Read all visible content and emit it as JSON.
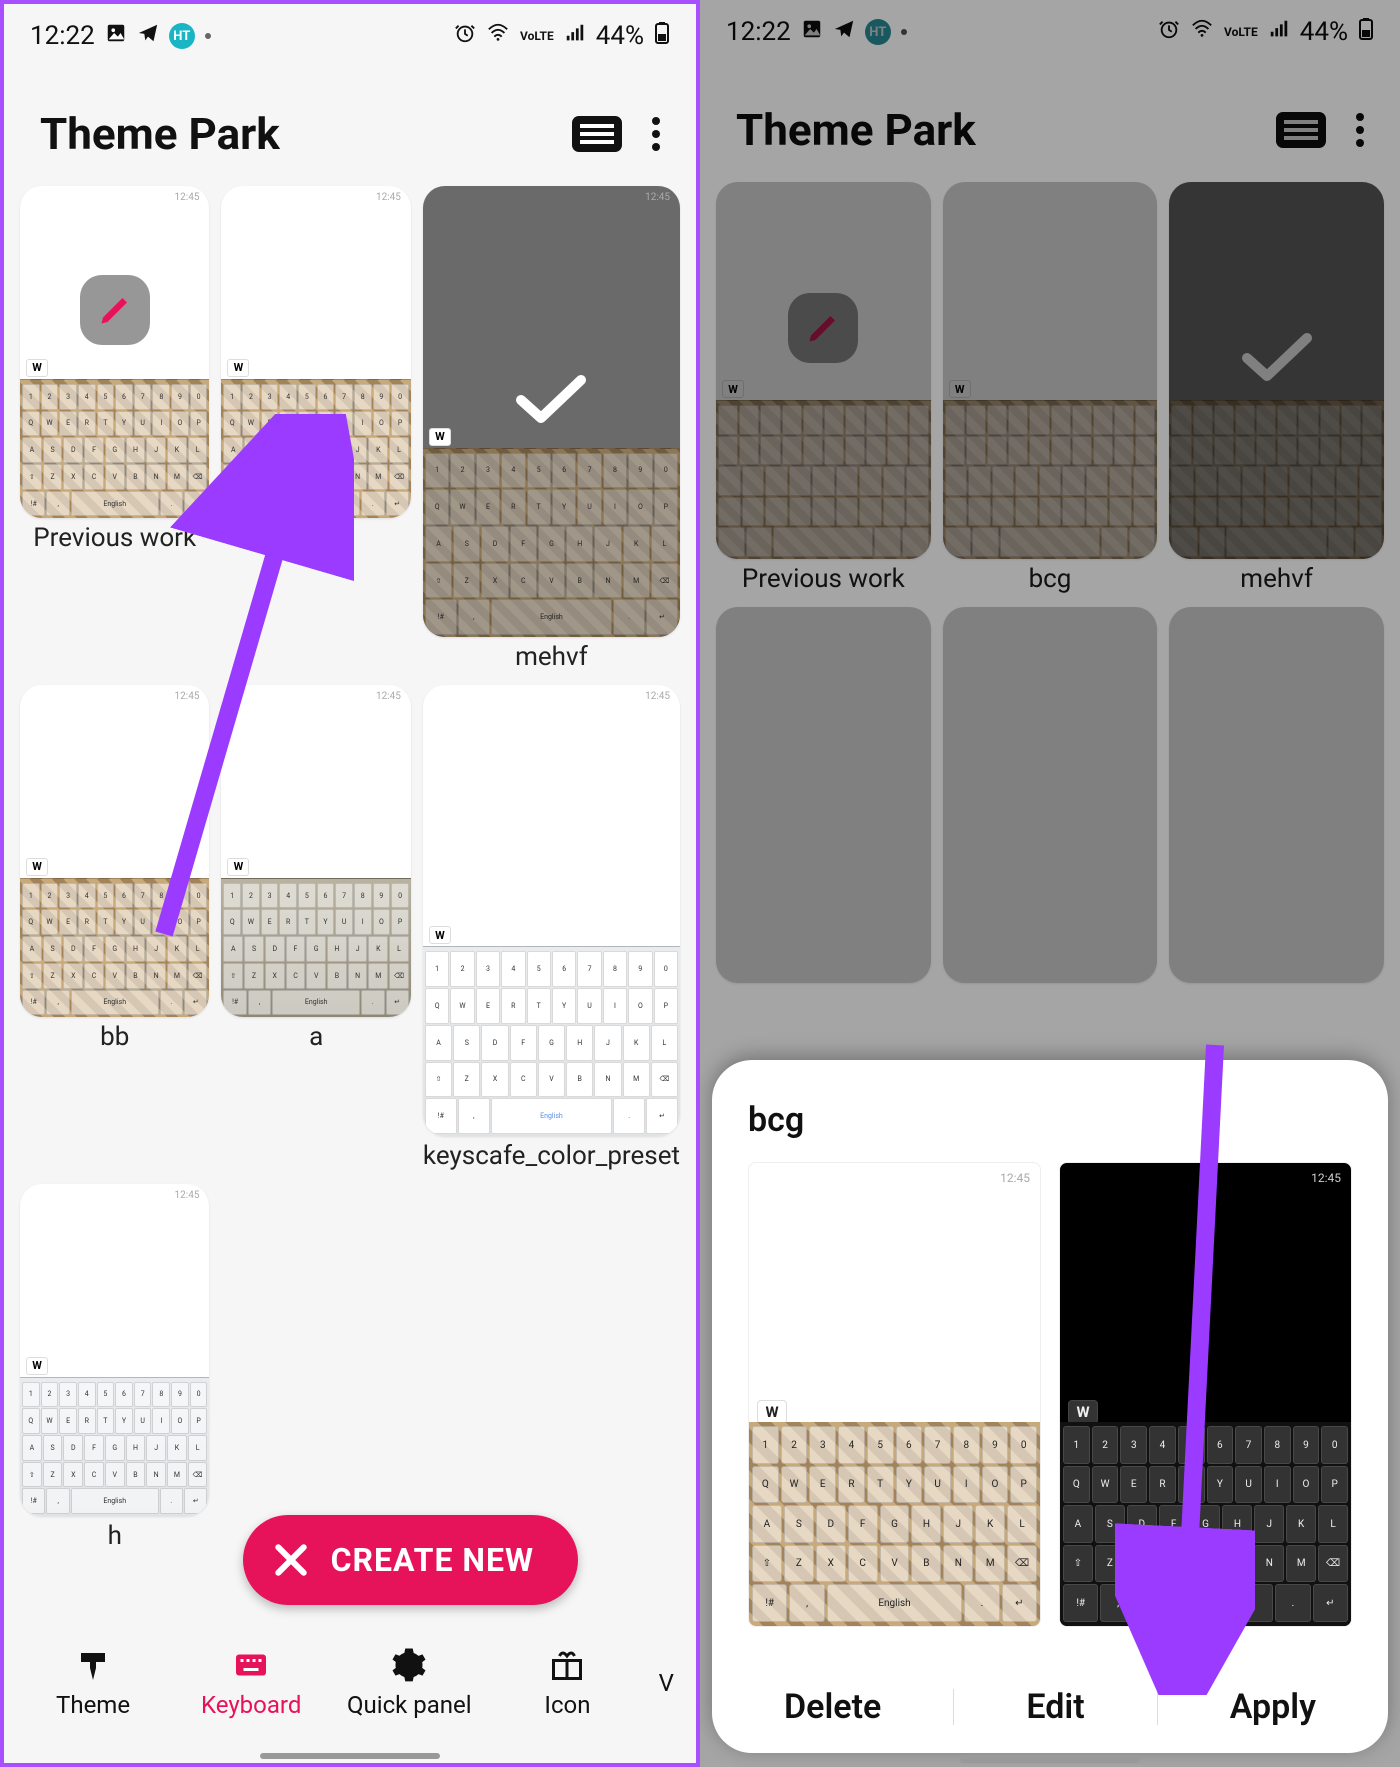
{
  "status": {
    "time": "12:22",
    "battery_text": "44%",
    "volte": "VoLTE"
  },
  "app": {
    "title": "Theme Park"
  },
  "themes": [
    {
      "label": "Previous work",
      "editing": true,
      "applied": false,
      "style": "textured"
    },
    {
      "label": "bcg",
      "editing": false,
      "applied": false,
      "style": "textured"
    },
    {
      "label": "mehvf",
      "editing": false,
      "applied": true,
      "style": "textured",
      "dark": true
    },
    {
      "label": "bb",
      "editing": false,
      "applied": false,
      "style": "textured"
    },
    {
      "label": "a",
      "editing": false,
      "applied": false,
      "style": "textured"
    },
    {
      "label": "keyscafe_color_preset",
      "editing": false,
      "applied": false,
      "style": "light"
    },
    {
      "label": "h",
      "editing": false,
      "applied": false,
      "style": "light"
    }
  ],
  "mini_status_text": "12:45",
  "suggest_letter": "W",
  "fab": {
    "label": "CREATE NEW"
  },
  "nav": [
    {
      "label": "Theme",
      "icon": "brush",
      "active": false
    },
    {
      "label": "Keyboard",
      "icon": "keyboard",
      "active": true
    },
    {
      "label": "Quick panel",
      "icon": "gear",
      "active": false
    },
    {
      "label": "Icon",
      "icon": "gift",
      "active": false
    }
  ],
  "nav_overflow_hint": "V",
  "sheet": {
    "title": "bcg",
    "previews": [
      {
        "mode": "light"
      },
      {
        "mode": "dark"
      }
    ],
    "actions": {
      "delete": "Delete",
      "edit": "Edit",
      "apply": "Apply"
    }
  },
  "kbd_rows": {
    "nums": [
      "1",
      "2",
      "3",
      "4",
      "5",
      "6",
      "7",
      "8",
      "9",
      "0"
    ],
    "r1": [
      "Q",
      "W",
      "E",
      "R",
      "T",
      "Y",
      "U",
      "I",
      "O",
      "P"
    ],
    "r2": [
      "A",
      "S",
      "D",
      "F",
      "G",
      "H",
      "J",
      "K",
      "L"
    ],
    "r3": [
      "Z",
      "X",
      "C",
      "V",
      "B",
      "N",
      "M"
    ]
  }
}
